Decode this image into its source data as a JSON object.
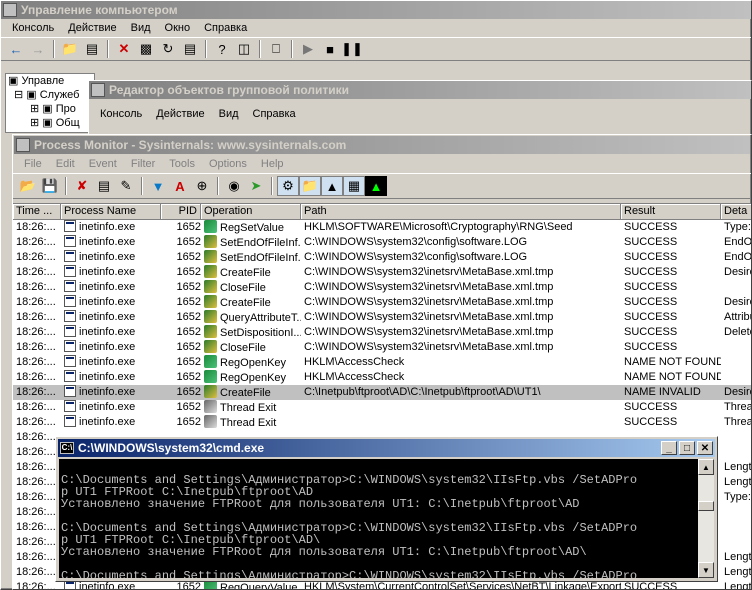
{
  "computer_management": {
    "title": "Управление компьютером",
    "menu": [
      "Консоль",
      "Действие",
      "Вид",
      "Окно",
      "Справка"
    ],
    "tree": [
      "Управле",
      "Служеб",
      "Про",
      "Общ"
    ]
  },
  "gpo_editor": {
    "title": "Редактор объектов групповой политики",
    "menu": [
      "Консоль",
      "Действие",
      "Вид",
      "Справка"
    ]
  },
  "procmon": {
    "title": "Process Monitor - Sysinternals: www.sysinternals.com",
    "menu": [
      "File",
      "Edit",
      "Event",
      "Filter",
      "Tools",
      "Options",
      "Help"
    ],
    "columns": [
      "Time ...",
      "Process Name",
      "PID",
      "Operation",
      "Path",
      "Result",
      "Deta"
    ],
    "rows": [
      {
        "time": "18:26:...",
        "proc": "inetinfo.exe",
        "pid": "1652",
        "op": "RegSetValue",
        "kind": "reg",
        "path": "HKLM\\SOFTWARE\\Microsoft\\Cryptography\\RNG\\Seed",
        "result": "SUCCESS",
        "detail": "Type:"
      },
      {
        "time": "18:26:...",
        "proc": "inetinfo.exe",
        "pid": "1652",
        "op": "SetEndOfFileInf...",
        "kind": "file",
        "path": "C:\\WINDOWS\\system32\\config\\software.LOG",
        "result": "SUCCESS",
        "detail": "EndO"
      },
      {
        "time": "18:26:...",
        "proc": "inetinfo.exe",
        "pid": "1652",
        "op": "SetEndOfFileInf...",
        "kind": "file",
        "path": "C:\\WINDOWS\\system32\\config\\software.LOG",
        "result": "SUCCESS",
        "detail": "EndO"
      },
      {
        "time": "18:26:...",
        "proc": "inetinfo.exe",
        "pid": "1652",
        "op": "CreateFile",
        "kind": "file",
        "path": "C:\\WINDOWS\\system32\\inetsrv\\MetaBase.xml.tmp",
        "result": "SUCCESS",
        "detail": "Desire"
      },
      {
        "time": "18:26:...",
        "proc": "inetinfo.exe",
        "pid": "1652",
        "op": "CloseFile",
        "kind": "file",
        "path": "C:\\WINDOWS\\system32\\inetsrv\\MetaBase.xml.tmp",
        "result": "SUCCESS",
        "detail": ""
      },
      {
        "time": "18:26:...",
        "proc": "inetinfo.exe",
        "pid": "1652",
        "op": "CreateFile",
        "kind": "file",
        "path": "C:\\WINDOWS\\system32\\inetsrv\\MetaBase.xml.tmp",
        "result": "SUCCESS",
        "detail": "Desire"
      },
      {
        "time": "18:26:...",
        "proc": "inetinfo.exe",
        "pid": "1652",
        "op": "QueryAttributeT...",
        "kind": "file",
        "path": "C:\\WINDOWS\\system32\\inetsrv\\MetaBase.xml.tmp",
        "result": "SUCCESS",
        "detail": "Attribu"
      },
      {
        "time": "18:26:...",
        "proc": "inetinfo.exe",
        "pid": "1652",
        "op": "SetDispositionI...",
        "kind": "file",
        "path": "C:\\WINDOWS\\system32\\inetsrv\\MetaBase.xml.tmp",
        "result": "SUCCESS",
        "detail": "Delete"
      },
      {
        "time": "18:26:...",
        "proc": "inetinfo.exe",
        "pid": "1652",
        "op": "CloseFile",
        "kind": "file",
        "path": "C:\\WINDOWS\\system32\\inetsrv\\MetaBase.xml.tmp",
        "result": "SUCCESS",
        "detail": ""
      },
      {
        "time": "18:26:...",
        "proc": "inetinfo.exe",
        "pid": "1652",
        "op": "RegOpenKey",
        "kind": "reg",
        "path": "HKLM\\AccessCheck",
        "result": "NAME NOT FOUND",
        "detail": ""
      },
      {
        "time": "18:26:...",
        "proc": "inetinfo.exe",
        "pid": "1652",
        "op": "RegOpenKey",
        "kind": "reg",
        "path": "HKLM\\AccessCheck",
        "result": "NAME NOT FOUND",
        "detail": ""
      },
      {
        "time": "18:26:...",
        "proc": "inetinfo.exe",
        "pid": "1652",
        "op": "CreateFile",
        "kind": "file",
        "path": "C:\\Inetpub\\ftproot\\AD\\C:\\Inetpub\\ftproot\\AD\\UT1\\",
        "result": "NAME INVALID",
        "detail": "Desire",
        "selected": true
      },
      {
        "time": "18:26:...",
        "proc": "inetinfo.exe",
        "pid": "1652",
        "op": "Thread Exit",
        "kind": "thr",
        "path": "",
        "result": "SUCCESS",
        "detail": "Threa"
      },
      {
        "time": "18:26:...",
        "proc": "inetinfo.exe",
        "pid": "1652",
        "op": "Thread Exit",
        "kind": "thr",
        "path": "",
        "result": "SUCCESS",
        "detail": "Threa"
      },
      {
        "time": "18:26:...",
        "proc": "",
        "pid": "",
        "op": "",
        "kind": "",
        "path": "",
        "result": "",
        "detail": ""
      },
      {
        "time": "18:26:...",
        "proc": "",
        "pid": "",
        "op": "",
        "kind": "",
        "path": "",
        "result": "",
        "detail": ""
      },
      {
        "time": "18:26:...",
        "proc": "",
        "pid": "",
        "op": "",
        "kind": "",
        "path": "",
        "result": "",
        "detail": "Lengt"
      },
      {
        "time": "18:26:...",
        "proc": "",
        "pid": "",
        "op": "",
        "kind": "",
        "path": "",
        "result": "",
        "detail": "Lengt"
      },
      {
        "time": "18:26:...",
        "proc": "",
        "pid": "",
        "op": "",
        "kind": "",
        "path": "",
        "result": "",
        "detail": "Type:"
      },
      {
        "time": "18:26:...",
        "proc": "",
        "pid": "",
        "op": "",
        "kind": "",
        "path": "",
        "result": "",
        "detail": ""
      },
      {
        "time": "18:26:...",
        "proc": "",
        "pid": "",
        "op": "",
        "kind": "",
        "path": "",
        "result": "",
        "detail": ""
      },
      {
        "time": "18:26:...",
        "proc": "",
        "pid": "",
        "op": "",
        "kind": "",
        "path": "",
        "result": "",
        "detail": ""
      },
      {
        "time": "18:26:...",
        "proc": "",
        "pid": "",
        "op": "",
        "kind": "",
        "path": "",
        "result": "",
        "detail": "Lengt"
      },
      {
        "time": "18:26:...",
        "proc": "",
        "pid": "",
        "op": "",
        "kind": "",
        "path": "",
        "result": "",
        "detail": "Lengt"
      },
      {
        "time": "18:26:...",
        "proc": "inetinfo.exe",
        "pid": "1652",
        "op": "RegQueryValue",
        "kind": "reg",
        "path": "HKLM\\System\\CurrentControlSet\\Services\\NetBT\\Linkage\\Export",
        "result": "SUCCESS",
        "detail": "Lengt"
      }
    ]
  },
  "cmd": {
    "title": "C:\\WINDOWS\\system32\\cmd.exe",
    "lines": [
      "",
      "C:\\Documents and Settings\\Администратор>C:\\WINDOWS\\system32\\IIsFtp.vbs /SetADPro",
      "p UT1 FTPRoot C:\\Inetpub\\ftproot\\AD",
      "Установлено значение FTPRoot для пользователя UT1: C:\\Inetpub\\ftproot\\AD",
      "",
      "C:\\Documents and Settings\\Администратор>C:\\WINDOWS\\system32\\IIsFtp.vbs /SetADPro",
      "p UT1 FTPRoot C:\\Inetpub\\ftproot\\AD\\",
      "Установлено значение FTPRoot для пользователя UT1: C:\\Inetpub\\ftproot\\AD\\",
      "",
      "C:\\Documents and Settings\\Администратор>C:\\WINDOWS\\system32\\IIsFtp.vbs /SetADPro"
    ]
  }
}
